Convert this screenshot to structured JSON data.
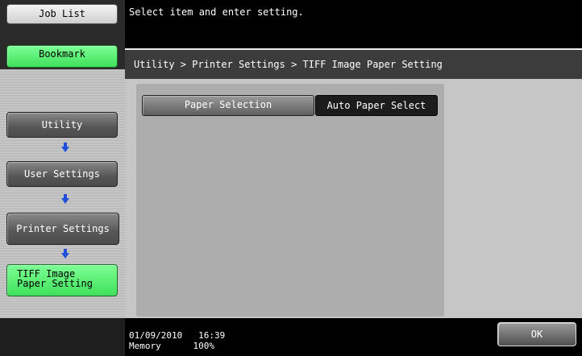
{
  "message": "Select item and enter setting.",
  "top_buttons": {
    "job_list": "Job List",
    "bookmark": "Bookmark"
  },
  "nav": {
    "utility": "Utility",
    "user_settings": "User Settings",
    "printer_settings": "Printer Settings",
    "tiff_line1": "TIFF Image",
    "tiff_line2": "Paper Setting"
  },
  "breadcrumb": "Utility > Printer Settings > TIFF Image Paper Setting",
  "setting": {
    "label": "Paper Selection",
    "value": "Auto Paper Select"
  },
  "footer": {
    "datetime": "01/09/2010   16:39",
    "memory": "Memory      100%",
    "ok": "OK"
  },
  "colors": {
    "active_green": "#3fe05a",
    "arrow_blue": "#1d4fd8"
  }
}
